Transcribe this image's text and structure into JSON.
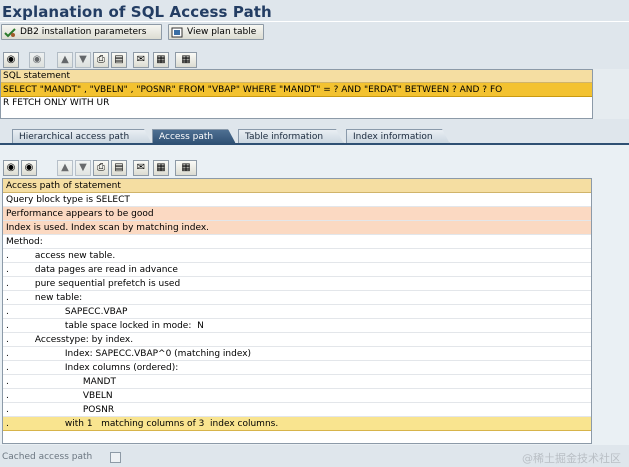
{
  "window": {
    "title": "Explanation of SQL Access Path"
  },
  "toolbar": {
    "db2_params_label": "DB2 installation parameters",
    "plan_table_label": "View plan table"
  },
  "sql": {
    "header": "SQL statement",
    "line1": "SELECT \"MANDT\" , \"VBELN\" , \"POSNR\" FROM \"VBAP\" WHERE \"MANDT\" = ? AND \"ERDAT\" BETWEEN ? AND ? FO",
    "line2": "R FETCH ONLY WITH UR"
  },
  "tabs": [
    {
      "label": "Hierarchical access path"
    },
    {
      "label": "Access path"
    },
    {
      "label": "Table information"
    },
    {
      "label": "Index information"
    }
  ],
  "access_path": {
    "header": "Access path of statement",
    "rows": [
      {
        "prefix": "",
        "text": "Query block type is SELECT"
      },
      {
        "prefix": "",
        "text": "Performance appears to be good"
      },
      {
        "prefix": "",
        "text": "Index is used. Index scan by matching index."
      },
      {
        "prefix": "",
        "text": "Method:"
      },
      {
        "prefix": ".",
        "text": "access new table."
      },
      {
        "prefix": ".",
        "text": "data pages are read in advance"
      },
      {
        "prefix": ".",
        "text": "pure sequential prefetch is used"
      },
      {
        "prefix": ".",
        "text": "new table:"
      },
      {
        "prefix": ".",
        "text": "SAPECC.VBAP"
      },
      {
        "prefix": ".",
        "text": "table space locked in mode:  N"
      },
      {
        "prefix": ".",
        "text": "Accesstype: by index."
      },
      {
        "prefix": ".",
        "text": "Index: SAPECC.VBAP^0 (matching index)"
      },
      {
        "prefix": ".",
        "text": "Index columns (ordered):"
      },
      {
        "prefix": ".",
        "text": "MANDT"
      },
      {
        "prefix": ".",
        "text": "VBELN"
      },
      {
        "prefix": ".",
        "text": "POSNR"
      },
      {
        "prefix": ".",
        "text": "with 1   matching columns of 3  index columns."
      }
    ]
  },
  "footer": {
    "cached_label": "Cached access path",
    "watermark": "@稀土掘金技术社区"
  },
  "colors": {
    "header": "#f5dea2",
    "selected": "#f3c230",
    "warning": "#fbd9c2",
    "tab_active": "#2f5073",
    "title": "#233d63"
  }
}
